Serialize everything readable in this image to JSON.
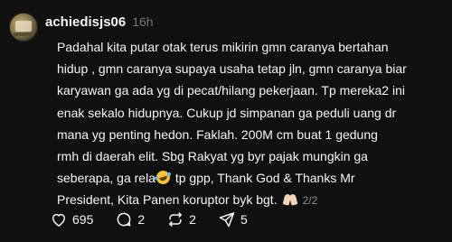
{
  "post": {
    "username": "achiedisjs06",
    "timestamp": "16h",
    "lines": [
      "Padahal kita putar otak terus mikirin gmn caranya bertahan",
      "hidup , gmn caranya supaya usaha tetap jln, gmn caranya biar",
      "karyawan ga ada yg di pecat/hilang pekerjaan. Tp mereka2 ini",
      "enak sekalo hidupnya. Cukup jd simpanan ga peduli uang dr",
      "mana yg penting hedon. Faklah. 200M cm buat 1 gedung",
      "rmh di daerah elit. Sbg Rakyat yg byr pajak mungkin ga",
      "seberapa, ga rela",
      " tp gpp, Thank God & Thanks Mr",
      "President, Kita Panen koruptor byk bgt."
    ],
    "page_indicator": "2/2"
  },
  "actions": {
    "likes": "695",
    "replies": "2",
    "reposts": "2",
    "shares": "5"
  },
  "icons": {
    "laugh_emoji": "rolling-on-floor-laughing-icon",
    "pray_emoji": "folded-hands-icon",
    "like": "heart-icon",
    "reply": "comment-icon",
    "repost": "repost-icon",
    "share": "send-icon"
  },
  "colors": {
    "background": "#101010",
    "text": "#f3f5f7",
    "muted": "#777777"
  }
}
